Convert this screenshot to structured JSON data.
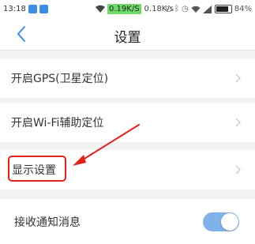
{
  "status_bar": {
    "time": "13:18",
    "net_speed_primary": "0.19K/S",
    "net_speed_secondary": "0.18K/s",
    "battery": "84%",
    "icons": [
      "notification-badge-icon",
      "wifi-icon",
      "alarm-icon",
      "bluetooth-icon",
      "signal-icon",
      "battery-icon"
    ]
  },
  "nav": {
    "back_icon": "chevron-left-icon",
    "title": "设置"
  },
  "settings": {
    "items": [
      {
        "label": "开启GPS(卫星定位)",
        "type": "link"
      },
      {
        "label": "开启Wi-Fi辅助定位",
        "type": "link"
      },
      {
        "label": "显示设置",
        "type": "link",
        "highlighted": true
      },
      {
        "label": "接收通知消息",
        "type": "toggle",
        "value": true
      }
    ]
  },
  "colors": {
    "accent": "#3a8ee6",
    "toggle_on": "#7fb2e8",
    "annotation": "#e0221b",
    "speed_highlight": "#6fd96a"
  }
}
